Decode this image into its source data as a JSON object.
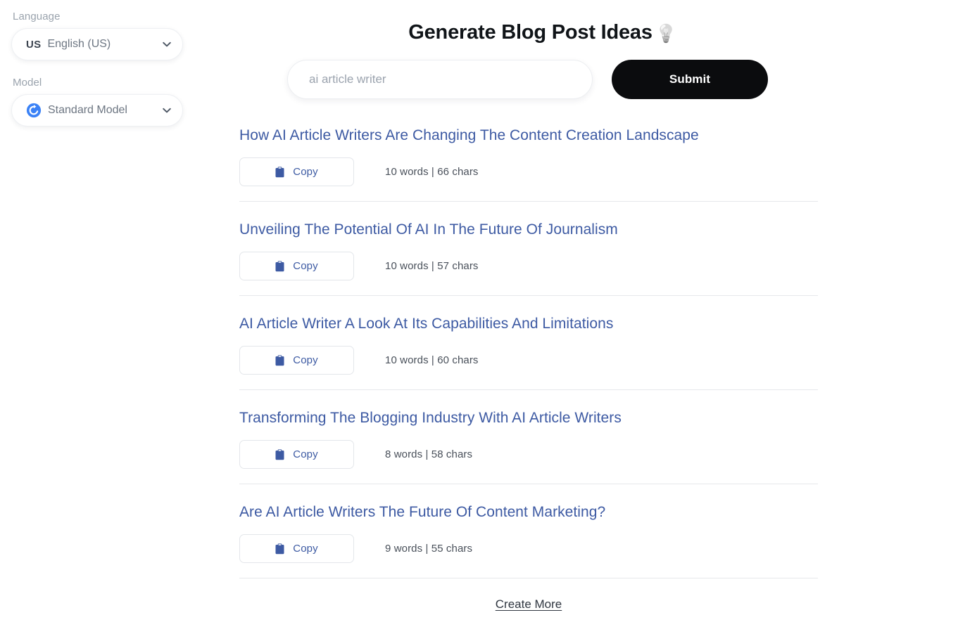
{
  "sidebar": {
    "language": {
      "label": "Language",
      "flag_code": "US",
      "value": "English (US)",
      "chevron_icon": "chevron-down-icon"
    },
    "model": {
      "label": "Model",
      "value": "Standard Model",
      "icon": "sync-circle-icon",
      "chevron_icon": "chevron-down-icon",
      "icon_color": "#3b82f6"
    }
  },
  "header": {
    "title": "Generate Blog Post Ideas",
    "title_emoji": "💡",
    "emoji_name": "lightbulb-icon"
  },
  "search": {
    "placeholder": "ai article writer",
    "value": "",
    "submit_label": "Submit",
    "submit_bg": "#0b0c0e"
  },
  "results": {
    "copy_label": "Copy",
    "copy_icon": "clipboard-icon",
    "accent_color": "#3d5aa3",
    "items": [
      {
        "title": "How AI Article Writers Are Changing The Content Creation Landscape",
        "stats": "10 words | 66 chars",
        "words": 10,
        "chars": 66
      },
      {
        "title": "Unveiling The Potential Of AI In The Future Of Journalism",
        "stats": "10 words | 57 chars",
        "words": 10,
        "chars": 57
      },
      {
        "title": "AI Article Writer A Look At Its Capabilities And Limitations",
        "stats": "10 words | 60 chars",
        "words": 10,
        "chars": 60
      },
      {
        "title": "Transforming The Blogging Industry With AI Article Writers",
        "stats": "8 words | 58 chars",
        "words": 8,
        "chars": 58
      },
      {
        "title": "Are AI Article Writers The Future Of Content Marketing?",
        "stats": "9 words | 55 chars",
        "words": 9,
        "chars": 55
      }
    ]
  },
  "footer": {
    "create_more_label": "Create More"
  }
}
